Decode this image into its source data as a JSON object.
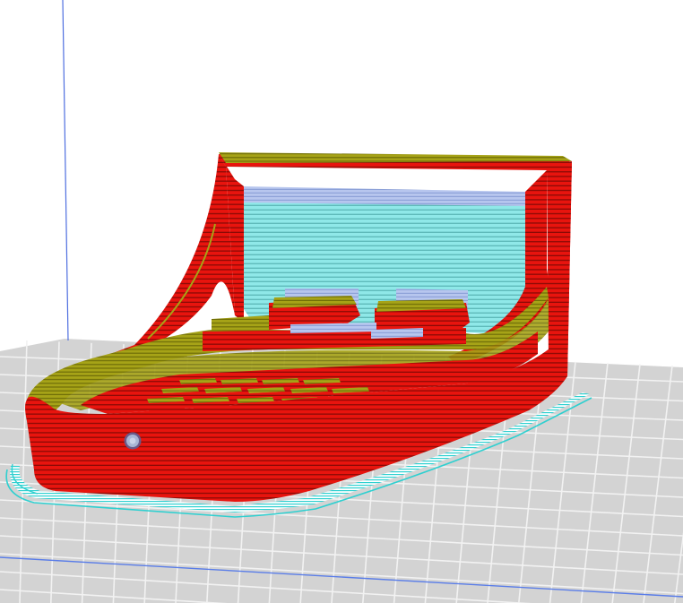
{
  "viewport": {
    "view": "layer-preview",
    "background_color": "#ffffff",
    "bed_color": "#d3d3d3",
    "bed_grid_color": "#f2f2f2",
    "axis_y_color": "#4f6fe0",
    "axis_x_color": "#5a7de8"
  },
  "model": {
    "wall_color": "#e8140e",
    "wall_line_color": "#8a0a06",
    "top_color": "#a6a317",
    "top_line_color": "#6f6d08",
    "support_color": "#8fe8e8",
    "support_line_color": "#5fbaba",
    "support_interface_color": "#b7c6ee",
    "skirt_color": "#2fd0d0"
  }
}
